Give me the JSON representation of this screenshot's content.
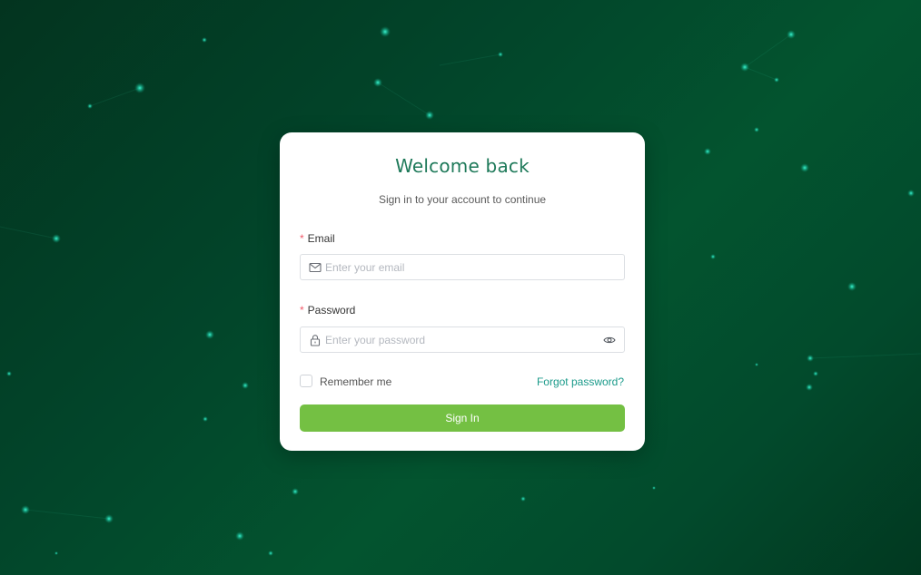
{
  "login": {
    "title": "Welcome back",
    "subtitle": "Sign in to your account to continue",
    "email": {
      "required_mark": "*",
      "label": "Email",
      "placeholder": "Enter your email",
      "value": "",
      "icon": "mail-icon"
    },
    "password": {
      "required_mark": "*",
      "label": "Password",
      "placeholder": "Enter your password",
      "value": "",
      "icon": "lock-icon",
      "toggle_icon": "eye-icon"
    },
    "remember_label": "Remember me",
    "remember_checked": false,
    "forgot_label": "Forgot password?",
    "submit_label": "Sign In"
  },
  "colors": {
    "accent": "#1f7a5a",
    "button": "#74c043",
    "link": "#1a9a8a",
    "required": "#f05a6a",
    "background": "#02452a"
  }
}
